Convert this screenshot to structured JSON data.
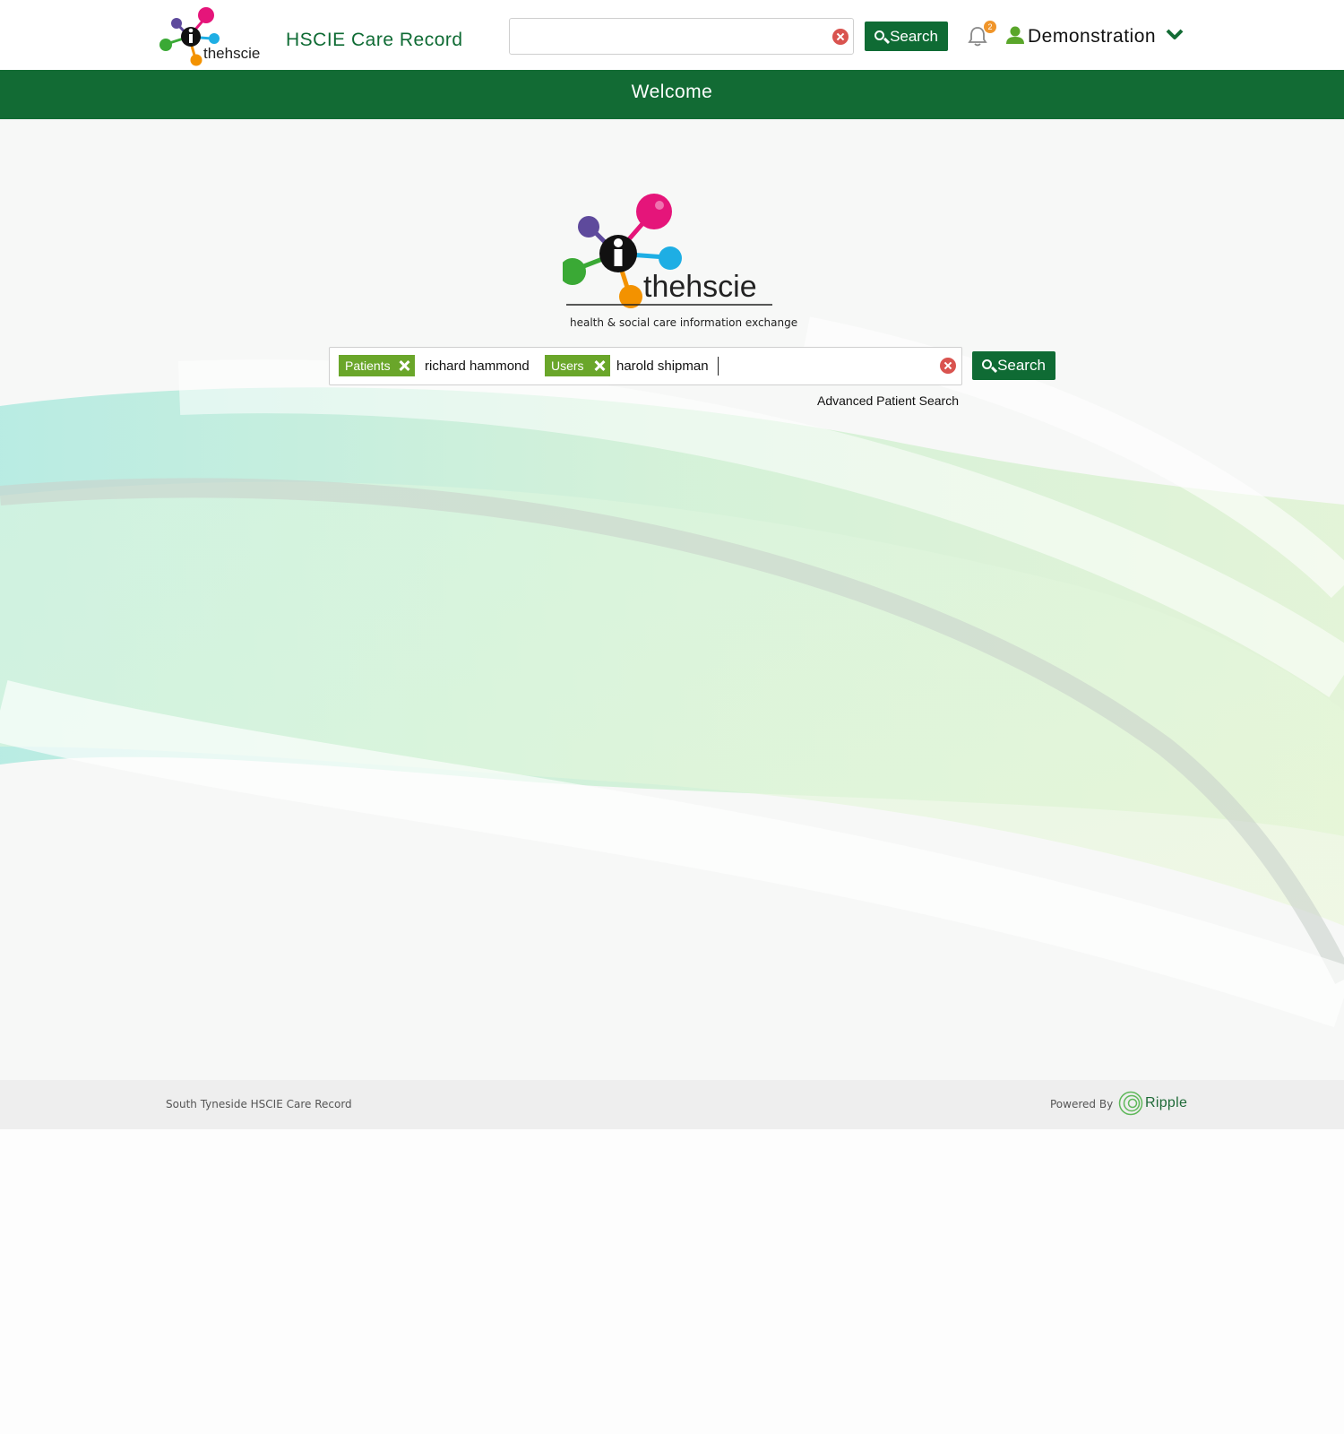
{
  "header": {
    "logo_text": "thehscie",
    "app_title": "HSCIE Care Record",
    "search_value": "",
    "search_button": "Search",
    "notification_count": "2",
    "user_name": "Demonstration"
  },
  "banner": {
    "title": "Welcome"
  },
  "main": {
    "logo_text": "thehscie",
    "tagline": "health & social care information exchange",
    "tags": [
      {
        "label": "Patients",
        "term": "richard hammond"
      },
      {
        "label": "Users",
        "term": "harold shipman"
      }
    ],
    "search_button": "Search",
    "advanced_link": "Advanced Patient Search"
  },
  "footer": {
    "left_text": "South Tyneside HSCIE Care Record",
    "powered_by": "Powered By",
    "brand": "Ripple"
  },
  "colors": {
    "primary_green": "#0f6b34",
    "tag_green": "#6aa62a",
    "badge_orange": "#f0952a",
    "clear_red": "#d9534f"
  },
  "icons": [
    "search-icon",
    "clear-icon",
    "bell-icon",
    "user-icon",
    "chevron-down-icon",
    "remove-tag-icon",
    "ripple-logo-icon"
  ]
}
